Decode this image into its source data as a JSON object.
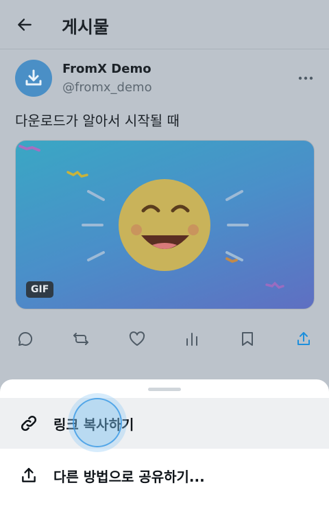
{
  "header": {
    "title": "게시물",
    "back_icon": "arrow-left-icon"
  },
  "post": {
    "author": {
      "display_name": "FromX Demo",
      "handle": "@fromx_demo",
      "avatar_icon": "download-tray-icon"
    },
    "more_icon": "more-horizontal-icon",
    "text": "다운로드가 알아서 시작될 때",
    "media": {
      "badge": "GIF",
      "content": "smiling-emoji"
    },
    "actions": [
      {
        "name": "reply",
        "icon": "reply-bubble-icon"
      },
      {
        "name": "repost",
        "icon": "repost-icon"
      },
      {
        "name": "like",
        "icon": "heart-icon"
      },
      {
        "name": "views",
        "icon": "bar-chart-icon"
      },
      {
        "name": "bookmark",
        "icon": "bookmark-icon"
      },
      {
        "name": "share",
        "icon": "share-icon"
      }
    ]
  },
  "share_sheet": {
    "items": [
      {
        "label": "링크 복사하기",
        "icon": "link-icon"
      },
      {
        "label": "다른 방법으로 공유하기...",
        "icon": "share-out-icon"
      }
    ]
  },
  "colors": {
    "accent": "#1d9bf0",
    "overlay_bg": "#bcc3cb",
    "icon_muted": "#4f5b66"
  }
}
